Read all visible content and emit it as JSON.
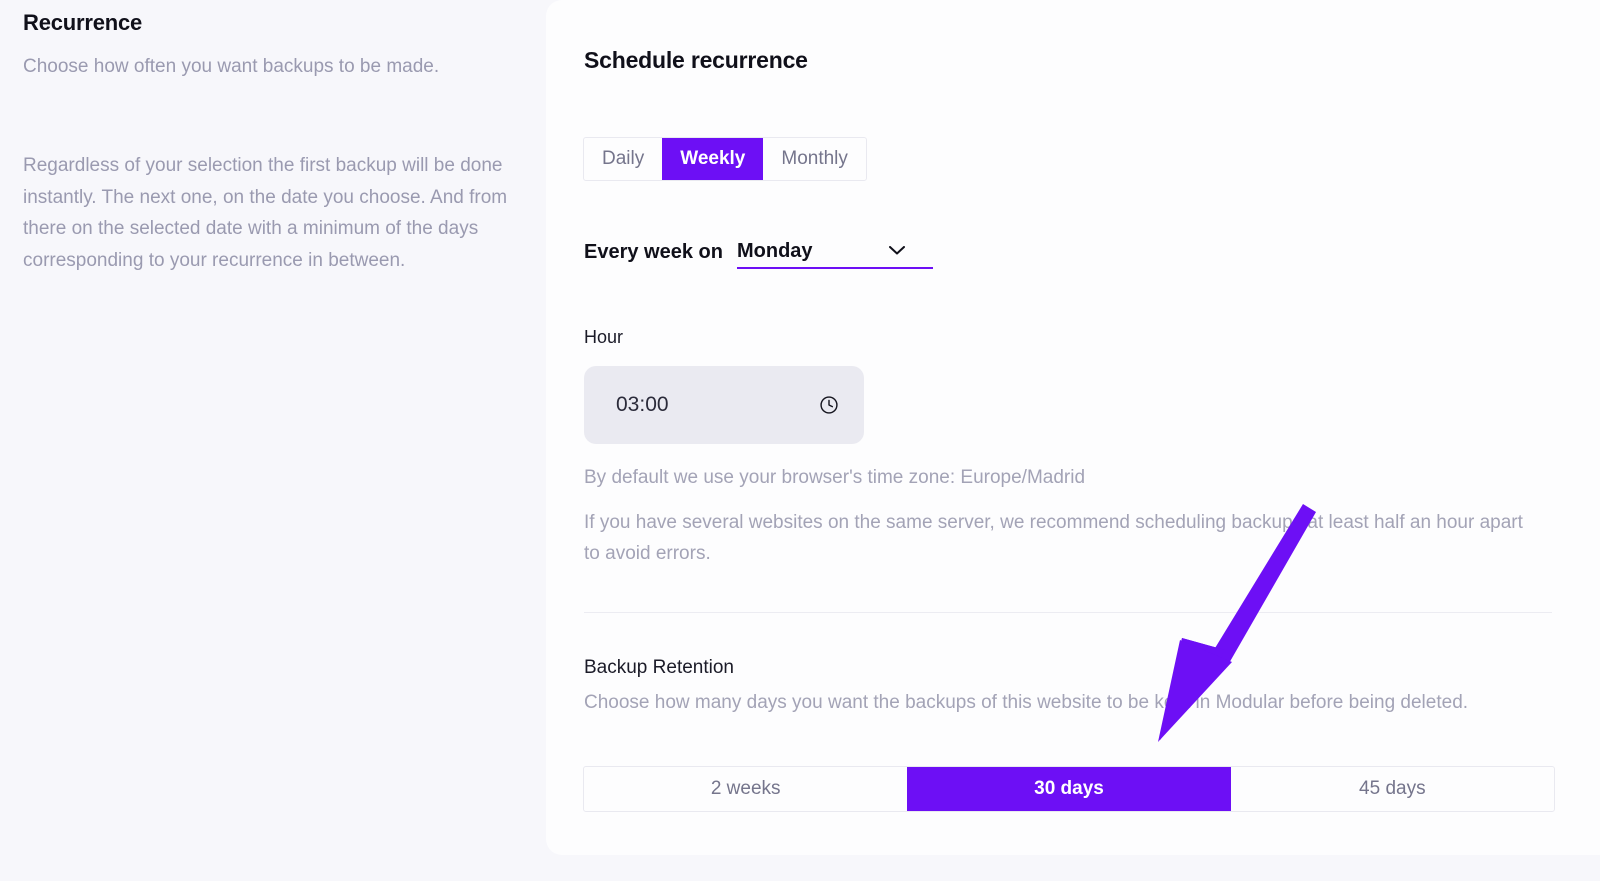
{
  "sidebar": {
    "title": "Recurrence",
    "description_1": "Choose how often you want backups to be made.",
    "description_2": "Regardless of your selection the first backup will be done instantly. The next one, on the date you choose. And from there on the selected date with a minimum of the days corresponding to your recurrence in between."
  },
  "panel": {
    "title": "Schedule recurrence",
    "recurrence_tabs": [
      {
        "label": "Daily",
        "selected": false
      },
      {
        "label": "Weekly",
        "selected": true
      },
      {
        "label": "Monthly",
        "selected": false
      }
    ],
    "weekday": {
      "label": "Every week on",
      "value": "Monday",
      "chevron_icon": "chevron-down-icon"
    },
    "hour": {
      "label": "Hour",
      "value": "03:00",
      "icon": "clock-icon"
    },
    "timezone_note": "By default we use your browser's time zone: Europe/Madrid",
    "server_note": "If you have several websites on the same server, we recommend scheduling backups at least half an hour apart to avoid errors.",
    "retention": {
      "title": "Backup Retention",
      "description": "Choose how many days you want the backups of this website to be kept in Modular before being deleted.",
      "options": [
        {
          "label": "2 weeks",
          "selected": false
        },
        {
          "label": "30 days",
          "selected": true
        },
        {
          "label": "45 days",
          "selected": false
        }
      ]
    }
  },
  "annotation": {
    "arrow_icon": "arrow-pointer-icon",
    "color": "#6d0ff5"
  },
  "colors": {
    "accent": "#6d0ff5",
    "page_background": "#f7f7fb",
    "panel_background": "#fdfdfe",
    "muted_text": "#a3a3b6",
    "heading_text": "#10101a"
  }
}
